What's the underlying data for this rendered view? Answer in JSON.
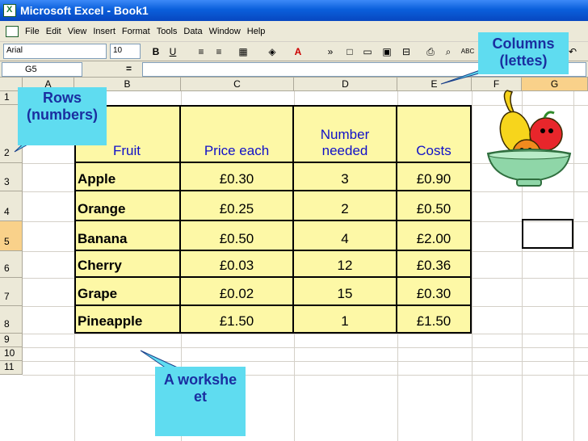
{
  "window": {
    "title": "Microsoft Excel - Book1"
  },
  "menu": [
    "File",
    "Edit",
    "View",
    "Insert",
    "Format",
    "Tools",
    "Data",
    "Window",
    "Help"
  ],
  "toolbar": {
    "font": "Arial",
    "size": "10",
    "bold": "B",
    "underline": "U"
  },
  "formula_bar": {
    "name_box": "G5",
    "fx": "="
  },
  "columns": [
    "A",
    "B",
    "C",
    "D",
    "E",
    "F",
    "G"
  ],
  "rows": [
    "1",
    "2",
    "3",
    "4",
    "5",
    "6",
    "7",
    "8",
    "9",
    "10",
    "11"
  ],
  "table": {
    "headers": [
      "Fruit",
      "Price each",
      "Number needed",
      "Costs"
    ],
    "rows": [
      {
        "fruit": "Apple",
        "price": "£0.30",
        "number": "3",
        "cost": "£0.90"
      },
      {
        "fruit": "Orange",
        "price": "£0.25",
        "number": "2",
        "cost": "£0.50"
      },
      {
        "fruit": "Banana",
        "price": "£0.50",
        "number": "4",
        "cost": "£2.00"
      },
      {
        "fruit": "Cherry",
        "price": "£0.03",
        "number": "12",
        "cost": "£0.36"
      },
      {
        "fruit": "Grape",
        "price": "£0.02",
        "number": "15",
        "cost": "£0.30"
      },
      {
        "fruit": "Pineapple",
        "price": "£1.50",
        "number": "1",
        "cost": "£1.50"
      }
    ]
  },
  "callouts": {
    "rows": "Rows (numbers)",
    "columns": "Columns (lettes)",
    "worksheet": "A worksheet"
  },
  "colors": {
    "table_fill": "#fdf8a6",
    "header_text": "#1010c8",
    "callout_fill": "#5fdcf0"
  }
}
